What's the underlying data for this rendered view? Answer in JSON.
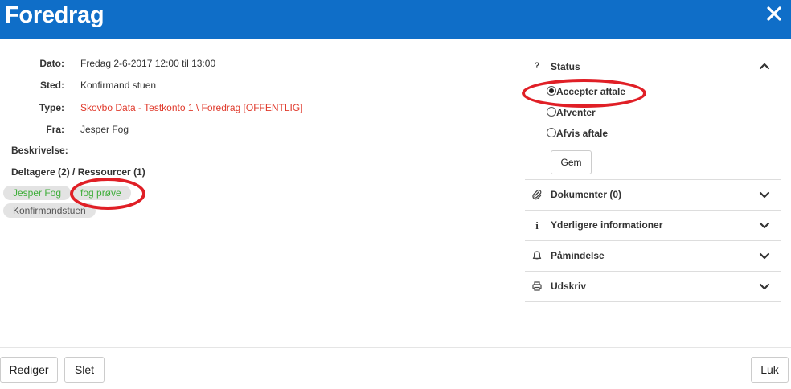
{
  "header": {
    "title": "Foredrag",
    "close_icon": "close-icon"
  },
  "details": {
    "dato": {
      "label": "Dato:",
      "value": "Fredag 2-6-2017 12:00 til 13:00"
    },
    "sted": {
      "label": "Sted:",
      "value": "Konfirmand stuen"
    },
    "type": {
      "label": "Type:",
      "value": "Skovbo Data - Testkonto 1 \\ Foredrag [OFFENTLIG]",
      "color": "#e03a2c"
    },
    "fra": {
      "label": "Fra:",
      "value": "Jesper Fog"
    },
    "beskrivelse_label": "Beskrivelse:",
    "deltagere_label": "Deltagere (2) / Ressourcer (1)",
    "participants": [
      "Jesper Fog",
      "fog prøve"
    ],
    "resources": [
      "Konfirmandstuen"
    ]
  },
  "status": {
    "title": "Status",
    "icon": "question-icon",
    "options": [
      {
        "label": "Accepter aftale",
        "checked": true
      },
      {
        "label": "Afventer",
        "checked": false
      },
      {
        "label": "Afvis aftale",
        "checked": false
      }
    ],
    "save_label": "Gem"
  },
  "sections": [
    {
      "label": "Dokumenter (0)",
      "icon": "paperclip-icon"
    },
    {
      "label": "Yderligere informationer",
      "icon": "info-icon"
    },
    {
      "label": "Påmindelse",
      "icon": "bell-icon"
    },
    {
      "label": "Udskriv",
      "icon": "print-icon"
    }
  ],
  "footer": {
    "edit_label": "Rediger",
    "delete_label": "Slet",
    "close_label": "Luk"
  },
  "colors": {
    "header": "#0f6ec8",
    "annotation": "#e01f26",
    "chip_text_green": "#3fae3a"
  }
}
